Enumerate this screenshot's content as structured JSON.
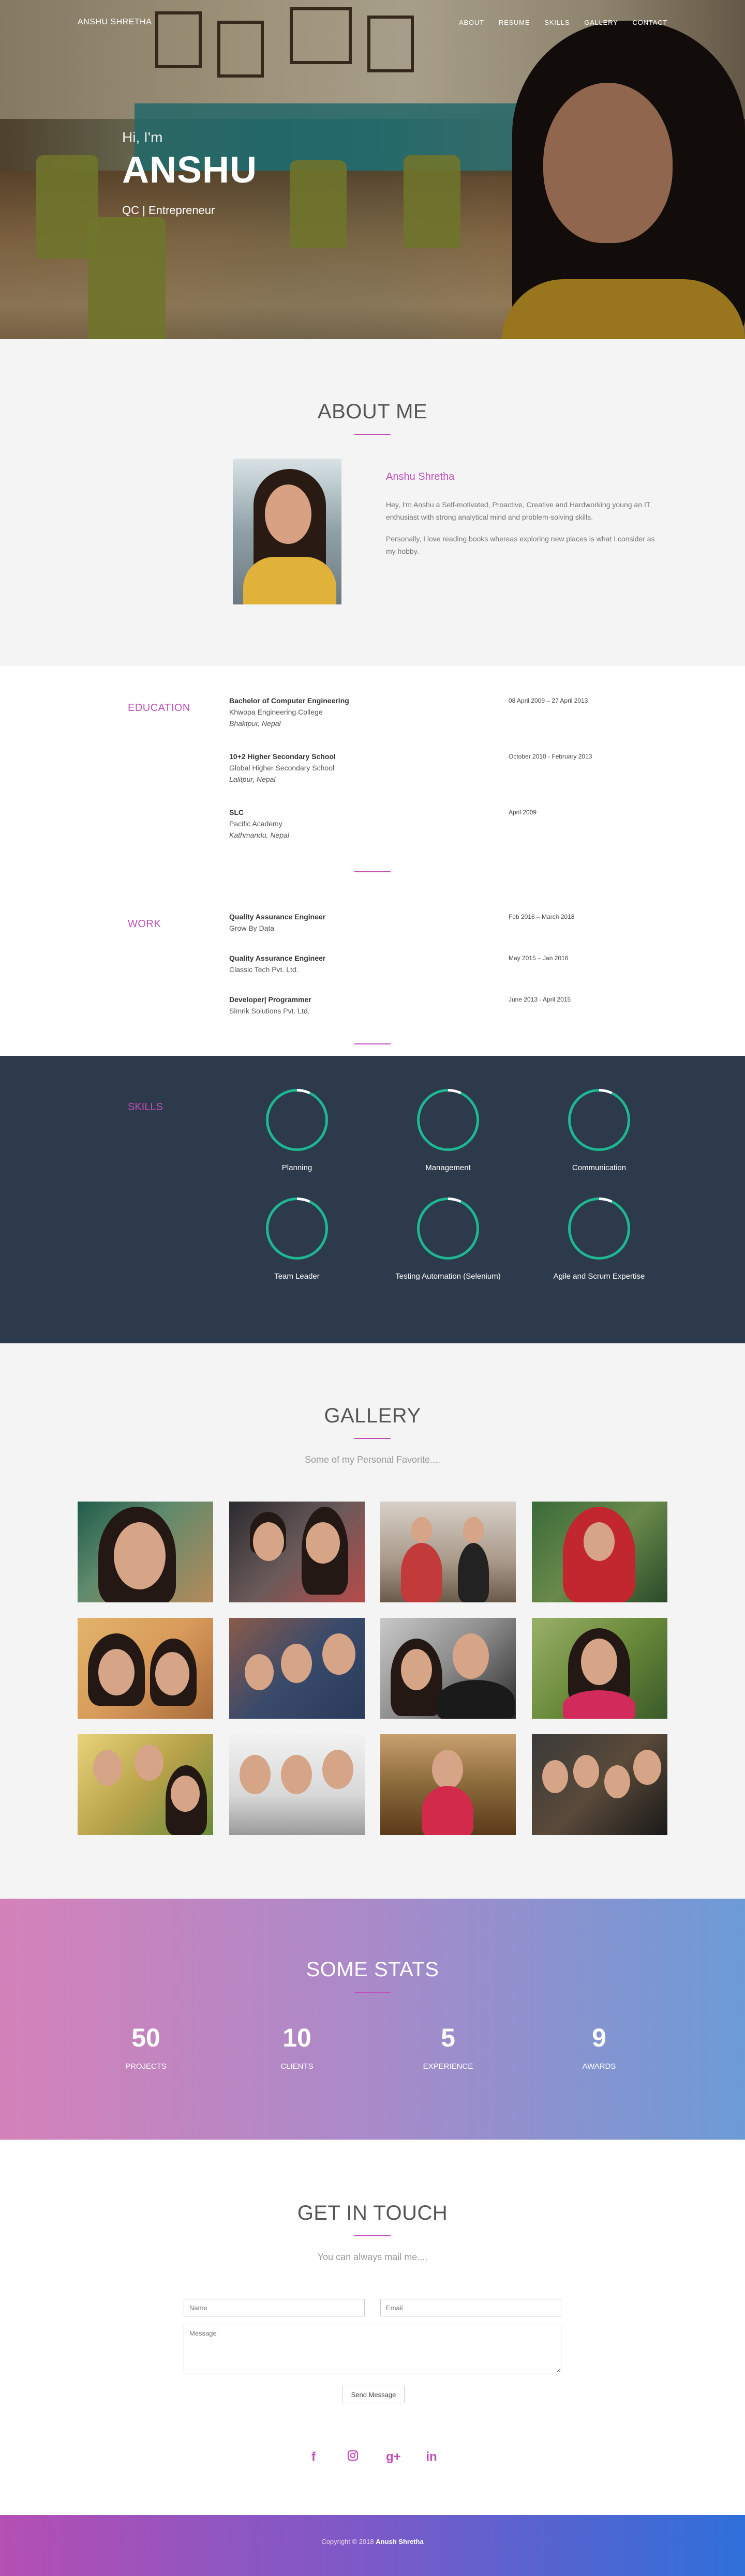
{
  "nav": {
    "brand": "ANSHU SHRETHA",
    "items": [
      "ABOUT",
      "RESUME",
      "SKILLS",
      "GALLERY",
      "CONTACT"
    ]
  },
  "hero": {
    "greeting": "Hi, I'm",
    "name": "ANSHU",
    "role": "QC | Entrepreneur"
  },
  "about": {
    "title": "ABOUT ME",
    "name": "Anshu Shretha",
    "para1": "Hey, I'm Anshu a Self-motivated, Proactive, Creative and Hardworking young an IT enthusiast with strong analytical mind and problem-solving skills.",
    "para2": "Personally, I love reading books whereas exploring new places is what I consider as my hobby."
  },
  "education": {
    "label": "EDUCATION",
    "items": [
      {
        "title": "Bachelor of Computer Engineering",
        "org": "Khwopa Engineering College",
        "place": "Bhaktpur, Nepal",
        "date": "08 April 2009 – 27 April 2013"
      },
      {
        "title": "10+2 Higher Secondary School",
        "org": "Global Higher Secondary School",
        "place": "Lalitpur, Nepal",
        "date": "October 2010 - February 2013"
      },
      {
        "title": "SLC",
        "org": "Pacific Academy",
        "place": "Kathmandu, Nepal",
        "date": "April 2009"
      }
    ]
  },
  "work": {
    "label": "WORK",
    "items": [
      {
        "title": "Quality Assurance Engineer",
        "org": "Grow By Data",
        "date": "Feb 2016 – March 2018"
      },
      {
        "title": "Quality Assurance Engineer",
        "org": "Classic Tech Pvt. Ltd.",
        "date": "May 2015 – Jan 2016"
      },
      {
        "title": "Developer| Programmer",
        "org": "Simrik Solutions Pvt. Ltd.",
        "date": "June 2013 - April 2015"
      }
    ]
  },
  "skills": {
    "label": "SKILLS",
    "items": [
      "Planning",
      "Management",
      "Communication",
      "Team Leader",
      "Testing Automation (Selenium)",
      "Agile and Scrum Expertise"
    ]
  },
  "gallery": {
    "title": "GALLERY",
    "subtitle": "Some of my Personal Favorite...."
  },
  "stats": {
    "title": "SOME STATS",
    "items": [
      {
        "value": "50",
        "label": "PROJECTS"
      },
      {
        "value": "10",
        "label": "CLIENTS"
      },
      {
        "value": "5",
        "label": "EXPERIENCE"
      },
      {
        "value": "9",
        "label": "AWARDS"
      }
    ]
  },
  "contact": {
    "title": "GET IN TOUCH",
    "subtitle": "You can always mail me....",
    "name_placeholder": "Name",
    "email_placeholder": "Email",
    "message_placeholder": "Message",
    "send_label": "Send Message"
  },
  "socials": [
    "facebook-icon",
    "instagram-icon",
    "google-plus-icon",
    "linkedin-icon"
  ],
  "footer": {
    "prefix": "Copyright © 2018",
    "name": "Anush Shretha"
  },
  "colors": {
    "accent": "#c14fb9",
    "skills_bg": "#2d3a4b",
    "ring": "#1db892"
  }
}
